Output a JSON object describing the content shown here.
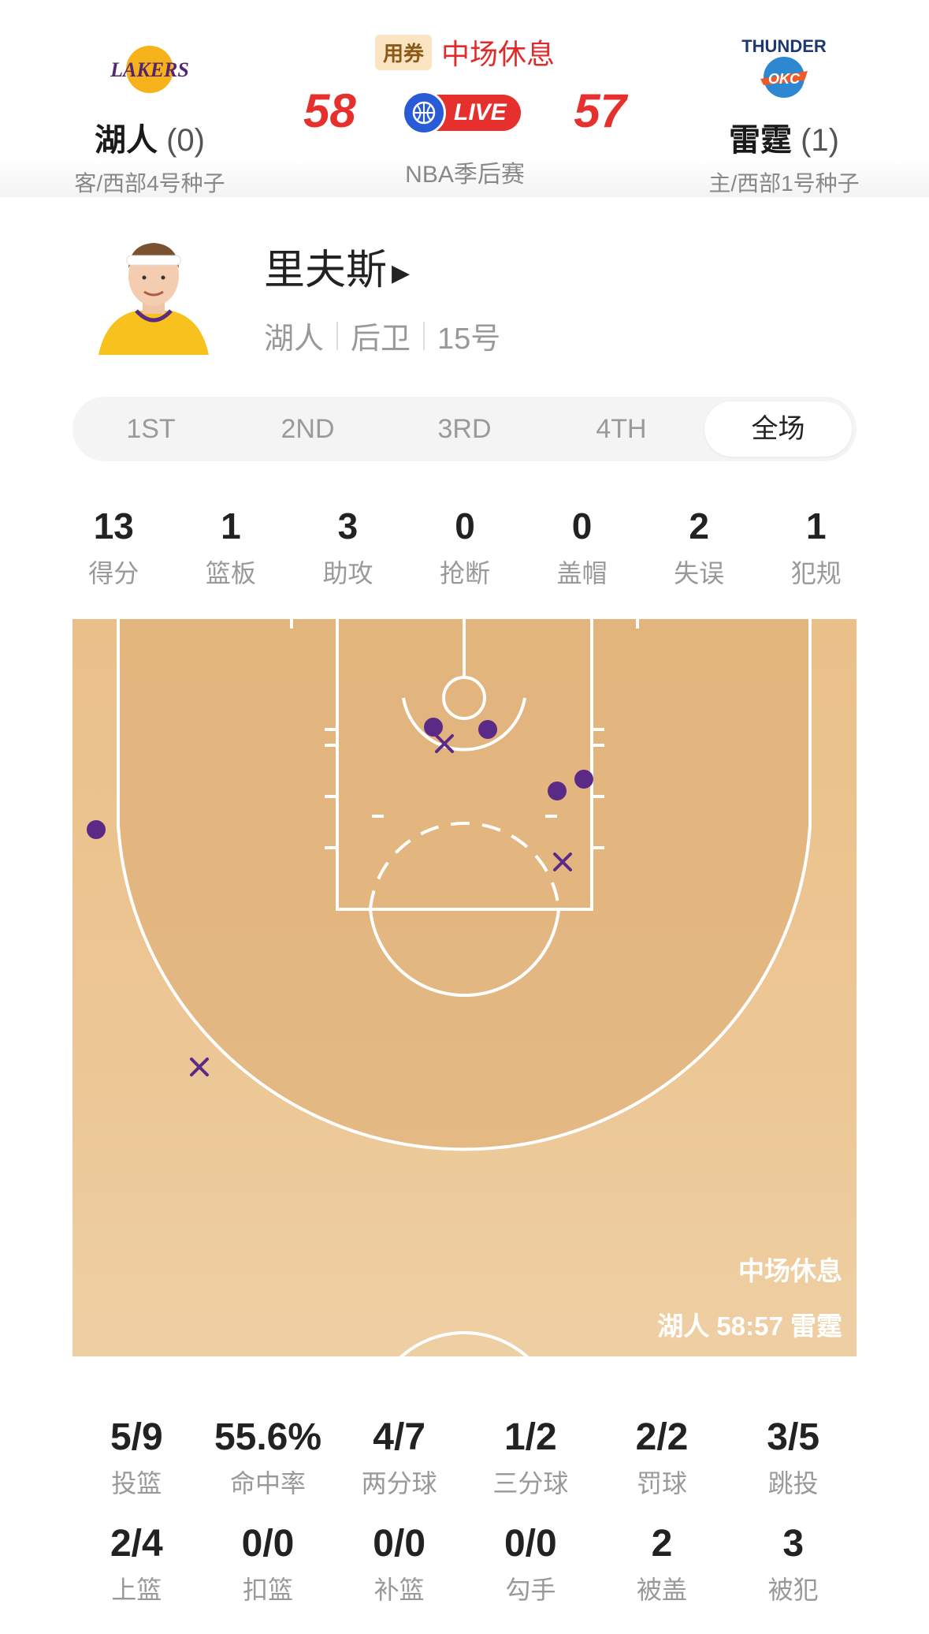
{
  "game": {
    "coupon_label": "用券",
    "status": "中场休息",
    "live_label": "LIVE",
    "league": "NBA季后赛",
    "away": {
      "name": "湖人",
      "wins": "(0)",
      "seed": "客/西部4号种子",
      "score": "58",
      "logo_icon": "lakers-logo"
    },
    "home": {
      "name": "雷霆",
      "wins": "(1)",
      "seed": "主/西部1号种子",
      "score": "57",
      "logo_icon": "thunder-logo"
    }
  },
  "player": {
    "name": "里夫斯",
    "team": "湖人",
    "position": "后卫",
    "number": "15号"
  },
  "tabs": [
    {
      "label": "1ST",
      "active": false
    },
    {
      "label": "2ND",
      "active": false
    },
    {
      "label": "3RD",
      "active": false
    },
    {
      "label": "4TH",
      "active": false
    },
    {
      "label": "全场",
      "active": true
    }
  ],
  "box_stats": [
    {
      "value": "13",
      "label": "得分"
    },
    {
      "value": "1",
      "label": "篮板"
    },
    {
      "value": "3",
      "label": "助攻"
    },
    {
      "value": "0",
      "label": "抢断"
    },
    {
      "value": "0",
      "label": "盖帽"
    },
    {
      "value": "2",
      "label": "失误"
    },
    {
      "value": "1",
      "label": "犯规"
    }
  ],
  "shot_chart": {
    "overlay_status": "中场休息",
    "overlay_score": "湖人 58:57 雷霆",
    "made_color": "#5b2a86",
    "missed_color": "#5b2a86"
  },
  "splits": [
    {
      "value": "5/9",
      "label": "投篮"
    },
    {
      "value": "55.6%",
      "label": "命中率"
    },
    {
      "value": "4/7",
      "label": "两分球"
    },
    {
      "value": "1/2",
      "label": "三分球"
    },
    {
      "value": "2/2",
      "label": "罚球"
    },
    {
      "value": "3/5",
      "label": "跳投"
    },
    {
      "value": "2/4",
      "label": "上篮"
    },
    {
      "value": "0/0",
      "label": "扣篮"
    },
    {
      "value": "0/0",
      "label": "补篮"
    },
    {
      "value": "0/0",
      "label": "勾手"
    },
    {
      "value": "2",
      "label": "被盖"
    },
    {
      "value": "3",
      "label": "被犯"
    }
  ]
}
